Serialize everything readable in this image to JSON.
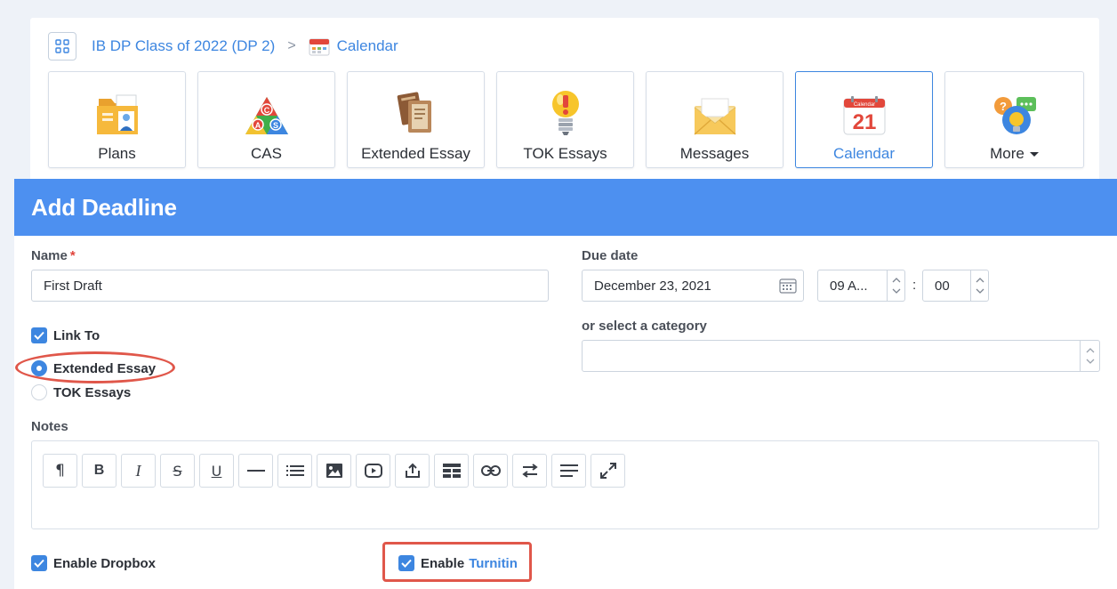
{
  "breadcrumb": {
    "grid_icon": "grid-icon",
    "class_name": "IB DP Class of 2022 (DP 2)",
    "separator": ">",
    "page": "Calendar",
    "page_icon": "calendar-icon"
  },
  "tiles": [
    {
      "label": "Plans",
      "icon": "plans-folder-icon",
      "active": false
    },
    {
      "label": "CAS",
      "icon": "cas-triangle-icon",
      "active": false
    },
    {
      "label": "Extended Essay",
      "icon": "books-icon",
      "active": false
    },
    {
      "label": "TOK Essays",
      "icon": "lightbulb-icon",
      "active": false
    },
    {
      "label": "Messages",
      "icon": "envelope-icon",
      "active": false
    },
    {
      "label": "Calendar",
      "icon": "calendar-21-icon",
      "active": true,
      "day": "21",
      "month": "Calendar"
    },
    {
      "label": "More",
      "icon": "question-chat-icon",
      "active": false
    }
  ],
  "modal": {
    "title": "Add Deadline",
    "name_label": "Name",
    "required_mark": "*",
    "name_value": "First Draft",
    "due_label": "Due date",
    "due_date": "December 23, 2021",
    "hour": "09 A...",
    "time_sep": ":",
    "minute": "00",
    "category_label": "or select a category",
    "category_value": "",
    "link_to_label": "Link To",
    "link_to_checked": true,
    "radio_options": [
      {
        "label": "Extended Essay",
        "selected": true
      },
      {
        "label": "TOK Essays",
        "selected": false
      }
    ],
    "notes_label": "Notes",
    "toolbar": [
      "paragraph-icon",
      "bold-icon",
      "italic-icon",
      "strikethrough-icon",
      "underline-icon",
      "horizontal-rule-icon",
      "list-icon",
      "image-icon",
      "video-icon",
      "upload-icon",
      "table-icon",
      "link-icon",
      "swap-icon",
      "align-icon",
      "fullscreen-icon"
    ],
    "toolbar_glyphs": {
      "paragraph": "¶",
      "bold": "B",
      "italic": "I",
      "strike": "S",
      "underline": "U"
    },
    "enable_dropbox_label": "Enable Dropbox",
    "enable_dropbox_checked": true,
    "enable_label": "Enable",
    "turnitin_label": "Turnitin",
    "enable_turnitin_checked": true
  },
  "colors": {
    "accent": "#4d90f0",
    "link": "#3d86e0",
    "highlight": "#e0574a"
  }
}
